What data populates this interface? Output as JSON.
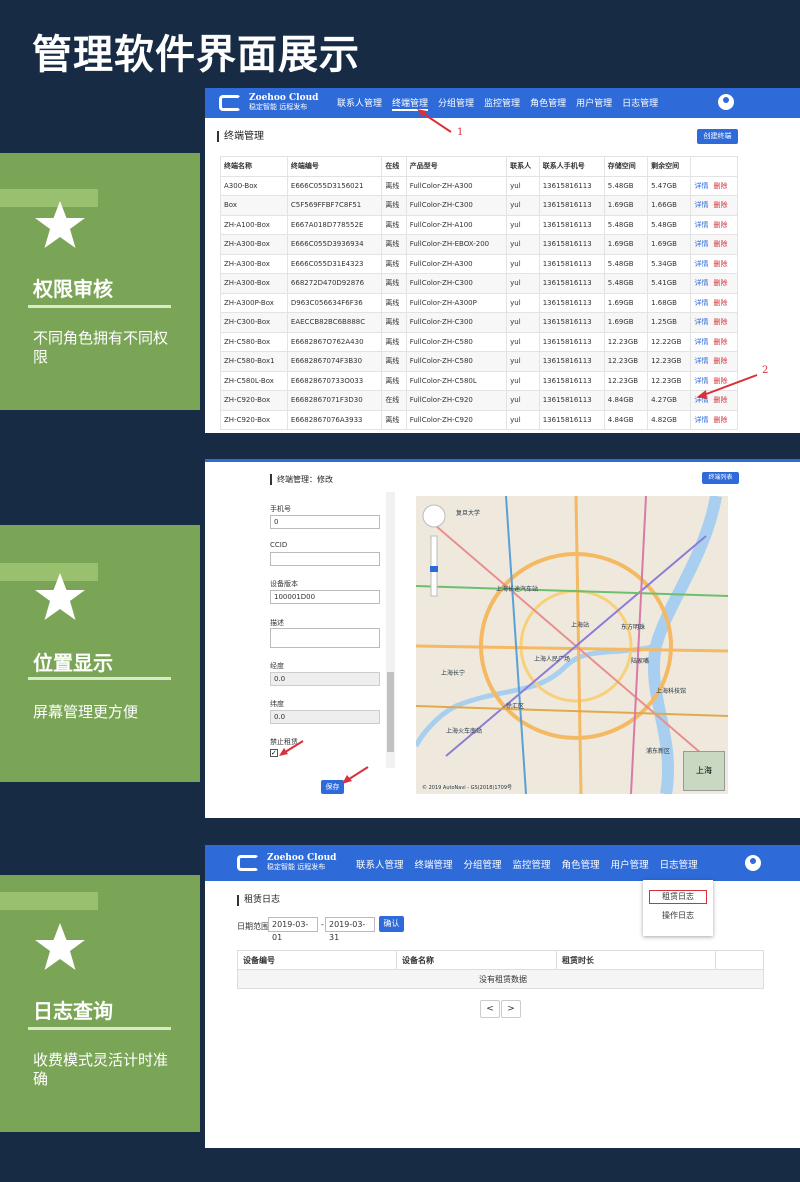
{
  "page_title": "管理软件界面展示",
  "features": [
    {
      "title": "权限审核",
      "desc": "不同角色拥有不同权限"
    },
    {
      "title": "位置显示",
      "desc": "屏幕管理更方便"
    },
    {
      "title": "日志查询",
      "desc": "收费模式灵活计时准确"
    }
  ],
  "app": {
    "brand": "Zoehoo Cloud",
    "slogan": "稳定智能 远程发布",
    "nav": [
      "联系人管理",
      "终端管理",
      "分组管理",
      "监控管理",
      "角色管理",
      "用户管理",
      "日志管理"
    ]
  },
  "terminal_list": {
    "title": "终端管理",
    "create_button": "创建终端",
    "columns": [
      "终端名称",
      "终端编号",
      "在线",
      "产品型号",
      "联系人",
      "联系人手机号",
      "存储空间",
      "剩余空间",
      ""
    ],
    "rows": [
      [
        "A300-Box",
        "E666C055D3156021",
        "离线",
        "FullColor-ZH-A300",
        "yul",
        "13615816113",
        "5.48GB",
        "5.47GB"
      ],
      [
        "Box",
        "C5F569FFBF7C8F51",
        "离线",
        "FullColor-ZH-C300",
        "yul",
        "13615816113",
        "1.69GB",
        "1.66GB"
      ],
      [
        "ZH-A100-Box",
        "E667A018D778552E",
        "离线",
        "FullColor-ZH-A100",
        "yul",
        "13615816113",
        "5.48GB",
        "5.48GB"
      ],
      [
        "ZH-A300-Box",
        "E666C055D3936934",
        "离线",
        "FullColor-ZH-EBOX-200",
        "yul",
        "13615816113",
        "1.69GB",
        "1.69GB"
      ],
      [
        "ZH-A300-Box",
        "E666C055D31E4323",
        "离线",
        "FullColor-ZH-A300",
        "yul",
        "13615816113",
        "5.48GB",
        "5.34GB"
      ],
      [
        "ZH-A300-Box",
        "668272D470D92876",
        "离线",
        "FullColor-ZH-C300",
        "yul",
        "13615816113",
        "5.48GB",
        "5.41GB"
      ],
      [
        "ZH-A300P-Box",
        "D963C056634F6F36",
        "离线",
        "FullColor-ZH-A300P",
        "yul",
        "13615816113",
        "1.69GB",
        "1.68GB"
      ],
      [
        "ZH-C300-Box",
        "EAECCB82BC6B888C",
        "离线",
        "FullColor-ZH-C300",
        "yul",
        "13615816113",
        "1.69GB",
        "1.25GB"
      ],
      [
        "ZH-C580-Box",
        "E6682867O762A430",
        "离线",
        "FullColor-ZH-C580",
        "yul",
        "13615816113",
        "12.23GB",
        "12.22GB"
      ],
      [
        "ZH-C580-Box1",
        "E6682867074F3B30",
        "离线",
        "FullColor-ZH-C580",
        "yul",
        "13615816113",
        "12.23GB",
        "12.23GB"
      ],
      [
        "ZH-C580L-Box",
        "E66828670733O033",
        "离线",
        "FullColor-ZH-C580L",
        "yul",
        "13615816113",
        "12.23GB",
        "12.23GB"
      ],
      [
        "ZH-C920-Box",
        "E6682867071F3D30",
        "在线",
        "FullColor-ZH-C920",
        "yul",
        "13615816113",
        "4.84GB",
        "4.27GB"
      ],
      [
        "ZH-C920-Box",
        "E6682867076A3933",
        "离线",
        "FullColor-ZH-C920",
        "yul",
        "13615816113",
        "4.84GB",
        "4.82GB"
      ]
    ],
    "detail_label": "详情",
    "delete_label": "删除",
    "annot1": "1",
    "annot2": "2"
  },
  "terminal_edit": {
    "title": "终端管理：修改",
    "list_button": "终端列表",
    "fields": [
      {
        "label": "手机号",
        "value": "0"
      },
      {
        "label": "CCID",
        "value": ""
      },
      {
        "label": "设备版本",
        "value": "100001D00"
      },
      {
        "label": "描述",
        "value": ""
      },
      {
        "label": "经度",
        "value": "0.0"
      },
      {
        "label": "纬度",
        "value": "0.0"
      }
    ],
    "ban_label": "禁止租赁",
    "save_button": "保存",
    "map_labels": [
      "上海长途汽车站",
      "上海站",
      "上海人民广场",
      "东方明珠",
      "上海科技馆",
      "上海火车南站",
      "上海长宁",
      "徐汇区",
      "浦东新区",
      "复旦大学",
      "陆家嘴"
    ],
    "map_copyright": "© 2019 AutoNavi - GS(2018)1709号",
    "map_corner_label": "上海"
  },
  "logs": {
    "dropdown": [
      "租赁日志",
      "操作日志"
    ],
    "title": "租赁日志",
    "date_label": "日期范围",
    "date_from": "2019-03-01",
    "date_sep": "-",
    "date_to": "2019-03-31",
    "confirm_button": "确认",
    "columns": [
      "设备编号",
      "设备名称",
      "租赁时长",
      ""
    ],
    "empty_text": "没有租赁数据",
    "prev": "<",
    "next": ">"
  },
  "colors": {
    "nav": "#2f6bd8",
    "card": "#7ba556",
    "background": "#172c44",
    "danger": "#d9303a"
  }
}
